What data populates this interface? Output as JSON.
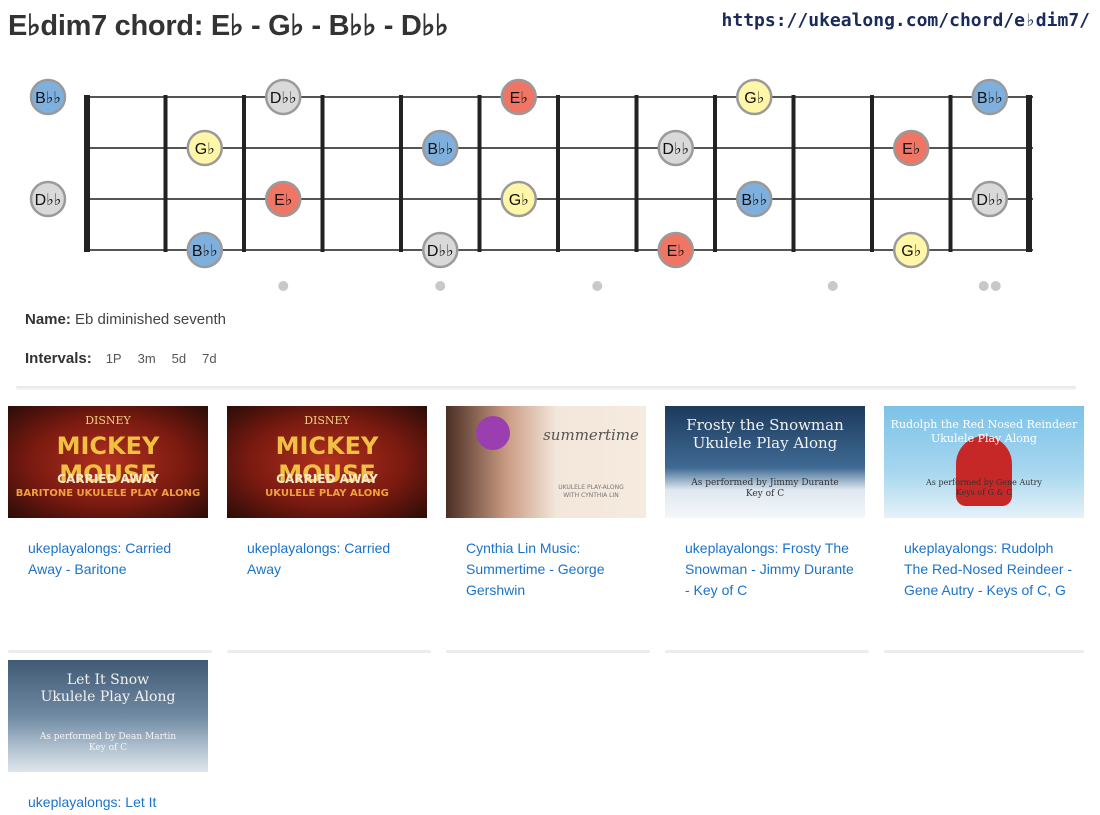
{
  "header": {
    "title": "E♭dim7 chord: E♭ - G♭ - B♭♭ - D♭♭",
    "url": "https://ukealong.com/chord/e♭dim7/"
  },
  "fretboard": {
    "strings": 4,
    "frets": 12,
    "open_notes": [
      "B♭♭",
      "",
      "D♭♭",
      ""
    ],
    "notes": [
      {
        "string": 1,
        "fret": 3,
        "label": "D♭♭",
        "color": "#d9d9d9"
      },
      {
        "string": 1,
        "fret": 6,
        "label": "E♭",
        "color": "#ef7564"
      },
      {
        "string": 1,
        "fret": 9,
        "label": "G♭",
        "color": "#fff6a8"
      },
      {
        "string": 1,
        "fret": 12,
        "label": "B♭♭",
        "color": "#7fb0dd"
      },
      {
        "string": 2,
        "fret": 2,
        "label": "G♭",
        "color": "#fff6a8"
      },
      {
        "string": 2,
        "fret": 5,
        "label": "B♭♭",
        "color": "#7fb0dd"
      },
      {
        "string": 2,
        "fret": 8,
        "label": "D♭♭",
        "color": "#d9d9d9"
      },
      {
        "string": 2,
        "fret": 11,
        "label": "E♭",
        "color": "#ef7564"
      },
      {
        "string": 3,
        "fret": 3,
        "label": "E♭",
        "color": "#ef7564"
      },
      {
        "string": 3,
        "fret": 6,
        "label": "G♭",
        "color": "#fff6a8"
      },
      {
        "string": 3,
        "fret": 9,
        "label": "B♭♭",
        "color": "#7fb0dd"
      },
      {
        "string": 3,
        "fret": 12,
        "label": "D♭♭",
        "color": "#d9d9d9"
      },
      {
        "string": 4,
        "fret": 2,
        "label": "B♭♭",
        "color": "#7fb0dd"
      },
      {
        "string": 4,
        "fret": 5,
        "label": "D♭♭",
        "color": "#d9d9d9"
      },
      {
        "string": 4,
        "fret": 8,
        "label": "E♭",
        "color": "#ef7564"
      },
      {
        "string": 4,
        "fret": 11,
        "label": "G♭",
        "color": "#fff6a8"
      }
    ],
    "open_colors": [
      "#7fb0dd",
      "",
      "#d9d9d9",
      ""
    ],
    "inlays": [
      3,
      5,
      7,
      10,
      12
    ]
  },
  "info": {
    "name_label": "Name:",
    "name_value": "Eb diminished seventh",
    "intervals_label": "Intervals:",
    "intervals": [
      "1P",
      "3m",
      "5d",
      "7d"
    ]
  },
  "videos": [
    {
      "title": "ukeplayalongs: Carried Away - Baritone",
      "thumb_line1": "DISNEY",
      "thumb_line2": "MICKEY MOUSE",
      "thumb_line3": "CARRIED AWAY",
      "thumb_line4": "BARITONE UKULELE PLAY ALONG"
    },
    {
      "title": "ukeplayalongs: Carried Away",
      "thumb_line1": "DISNEY",
      "thumb_line2": "MICKEY MOUSE",
      "thumb_line3": "CARRIED AWAY",
      "thumb_line4": "UKULELE PLAY ALONG"
    },
    {
      "title": "Cynthia Lin Music: Summertime - George Gershwin",
      "thumb_line1": "summertime",
      "thumb_line2": "UKULELE PLAY-ALONG",
      "thumb_line3": "WITH CYNTHIA LIN",
      "thumb_line4": ""
    },
    {
      "title": "ukeplayalongs: Frosty The Snowman - Jimmy Durante - Key of C",
      "thumb_line1": "Frosty the Snowman",
      "thumb_line2": "Ukulele Play Along",
      "thumb_line3": "As performed by Jimmy Durante",
      "thumb_line4": "Key of C"
    },
    {
      "title": "ukeplayalongs: Rudolph The Red-Nosed Reindeer - Gene Autry - Keys of C, G",
      "thumb_line1": "Rudolph the Red Nosed Reindeer",
      "thumb_line2": "Ukulele Play Along",
      "thumb_line3": "As performed by Gene Autry",
      "thumb_line4": "Keys of G & C"
    },
    {
      "title": "ukeplayalongs: Let It",
      "thumb_line1": "Let It Snow",
      "thumb_line2": "Ukulele Play Along",
      "thumb_line3": "As performed by Dean Martin",
      "thumb_line4": "Key of C"
    }
  ]
}
